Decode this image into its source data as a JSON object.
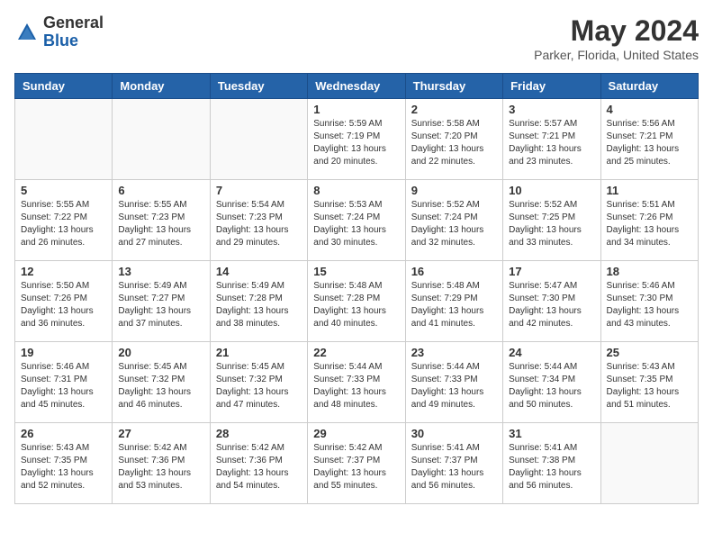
{
  "header": {
    "logo_general": "General",
    "logo_blue": "Blue",
    "month_title": "May 2024",
    "location": "Parker, Florida, United States"
  },
  "weekdays": [
    "Sunday",
    "Monday",
    "Tuesday",
    "Wednesday",
    "Thursday",
    "Friday",
    "Saturday"
  ],
  "weeks": [
    [
      {
        "day": "",
        "info": ""
      },
      {
        "day": "",
        "info": ""
      },
      {
        "day": "",
        "info": ""
      },
      {
        "day": "1",
        "info": "Sunrise: 5:59 AM\nSunset: 7:19 PM\nDaylight: 13 hours\nand 20 minutes."
      },
      {
        "day": "2",
        "info": "Sunrise: 5:58 AM\nSunset: 7:20 PM\nDaylight: 13 hours\nand 22 minutes."
      },
      {
        "day": "3",
        "info": "Sunrise: 5:57 AM\nSunset: 7:21 PM\nDaylight: 13 hours\nand 23 minutes."
      },
      {
        "day": "4",
        "info": "Sunrise: 5:56 AM\nSunset: 7:21 PM\nDaylight: 13 hours\nand 25 minutes."
      }
    ],
    [
      {
        "day": "5",
        "info": "Sunrise: 5:55 AM\nSunset: 7:22 PM\nDaylight: 13 hours\nand 26 minutes."
      },
      {
        "day": "6",
        "info": "Sunrise: 5:55 AM\nSunset: 7:23 PM\nDaylight: 13 hours\nand 27 minutes."
      },
      {
        "day": "7",
        "info": "Sunrise: 5:54 AM\nSunset: 7:23 PM\nDaylight: 13 hours\nand 29 minutes."
      },
      {
        "day": "8",
        "info": "Sunrise: 5:53 AM\nSunset: 7:24 PM\nDaylight: 13 hours\nand 30 minutes."
      },
      {
        "day": "9",
        "info": "Sunrise: 5:52 AM\nSunset: 7:24 PM\nDaylight: 13 hours\nand 32 minutes."
      },
      {
        "day": "10",
        "info": "Sunrise: 5:52 AM\nSunset: 7:25 PM\nDaylight: 13 hours\nand 33 minutes."
      },
      {
        "day": "11",
        "info": "Sunrise: 5:51 AM\nSunset: 7:26 PM\nDaylight: 13 hours\nand 34 minutes."
      }
    ],
    [
      {
        "day": "12",
        "info": "Sunrise: 5:50 AM\nSunset: 7:26 PM\nDaylight: 13 hours\nand 36 minutes."
      },
      {
        "day": "13",
        "info": "Sunrise: 5:49 AM\nSunset: 7:27 PM\nDaylight: 13 hours\nand 37 minutes."
      },
      {
        "day": "14",
        "info": "Sunrise: 5:49 AM\nSunset: 7:28 PM\nDaylight: 13 hours\nand 38 minutes."
      },
      {
        "day": "15",
        "info": "Sunrise: 5:48 AM\nSunset: 7:28 PM\nDaylight: 13 hours\nand 40 minutes."
      },
      {
        "day": "16",
        "info": "Sunrise: 5:48 AM\nSunset: 7:29 PM\nDaylight: 13 hours\nand 41 minutes."
      },
      {
        "day": "17",
        "info": "Sunrise: 5:47 AM\nSunset: 7:30 PM\nDaylight: 13 hours\nand 42 minutes."
      },
      {
        "day": "18",
        "info": "Sunrise: 5:46 AM\nSunset: 7:30 PM\nDaylight: 13 hours\nand 43 minutes."
      }
    ],
    [
      {
        "day": "19",
        "info": "Sunrise: 5:46 AM\nSunset: 7:31 PM\nDaylight: 13 hours\nand 45 minutes."
      },
      {
        "day": "20",
        "info": "Sunrise: 5:45 AM\nSunset: 7:32 PM\nDaylight: 13 hours\nand 46 minutes."
      },
      {
        "day": "21",
        "info": "Sunrise: 5:45 AM\nSunset: 7:32 PM\nDaylight: 13 hours\nand 47 minutes."
      },
      {
        "day": "22",
        "info": "Sunrise: 5:44 AM\nSunset: 7:33 PM\nDaylight: 13 hours\nand 48 minutes."
      },
      {
        "day": "23",
        "info": "Sunrise: 5:44 AM\nSunset: 7:33 PM\nDaylight: 13 hours\nand 49 minutes."
      },
      {
        "day": "24",
        "info": "Sunrise: 5:44 AM\nSunset: 7:34 PM\nDaylight: 13 hours\nand 50 minutes."
      },
      {
        "day": "25",
        "info": "Sunrise: 5:43 AM\nSunset: 7:35 PM\nDaylight: 13 hours\nand 51 minutes."
      }
    ],
    [
      {
        "day": "26",
        "info": "Sunrise: 5:43 AM\nSunset: 7:35 PM\nDaylight: 13 hours\nand 52 minutes."
      },
      {
        "day": "27",
        "info": "Sunrise: 5:42 AM\nSunset: 7:36 PM\nDaylight: 13 hours\nand 53 minutes."
      },
      {
        "day": "28",
        "info": "Sunrise: 5:42 AM\nSunset: 7:36 PM\nDaylight: 13 hours\nand 54 minutes."
      },
      {
        "day": "29",
        "info": "Sunrise: 5:42 AM\nSunset: 7:37 PM\nDaylight: 13 hours\nand 55 minutes."
      },
      {
        "day": "30",
        "info": "Sunrise: 5:41 AM\nSunset: 7:37 PM\nDaylight: 13 hours\nand 56 minutes."
      },
      {
        "day": "31",
        "info": "Sunrise: 5:41 AM\nSunset: 7:38 PM\nDaylight: 13 hours\nand 56 minutes."
      },
      {
        "day": "",
        "info": ""
      }
    ]
  ]
}
